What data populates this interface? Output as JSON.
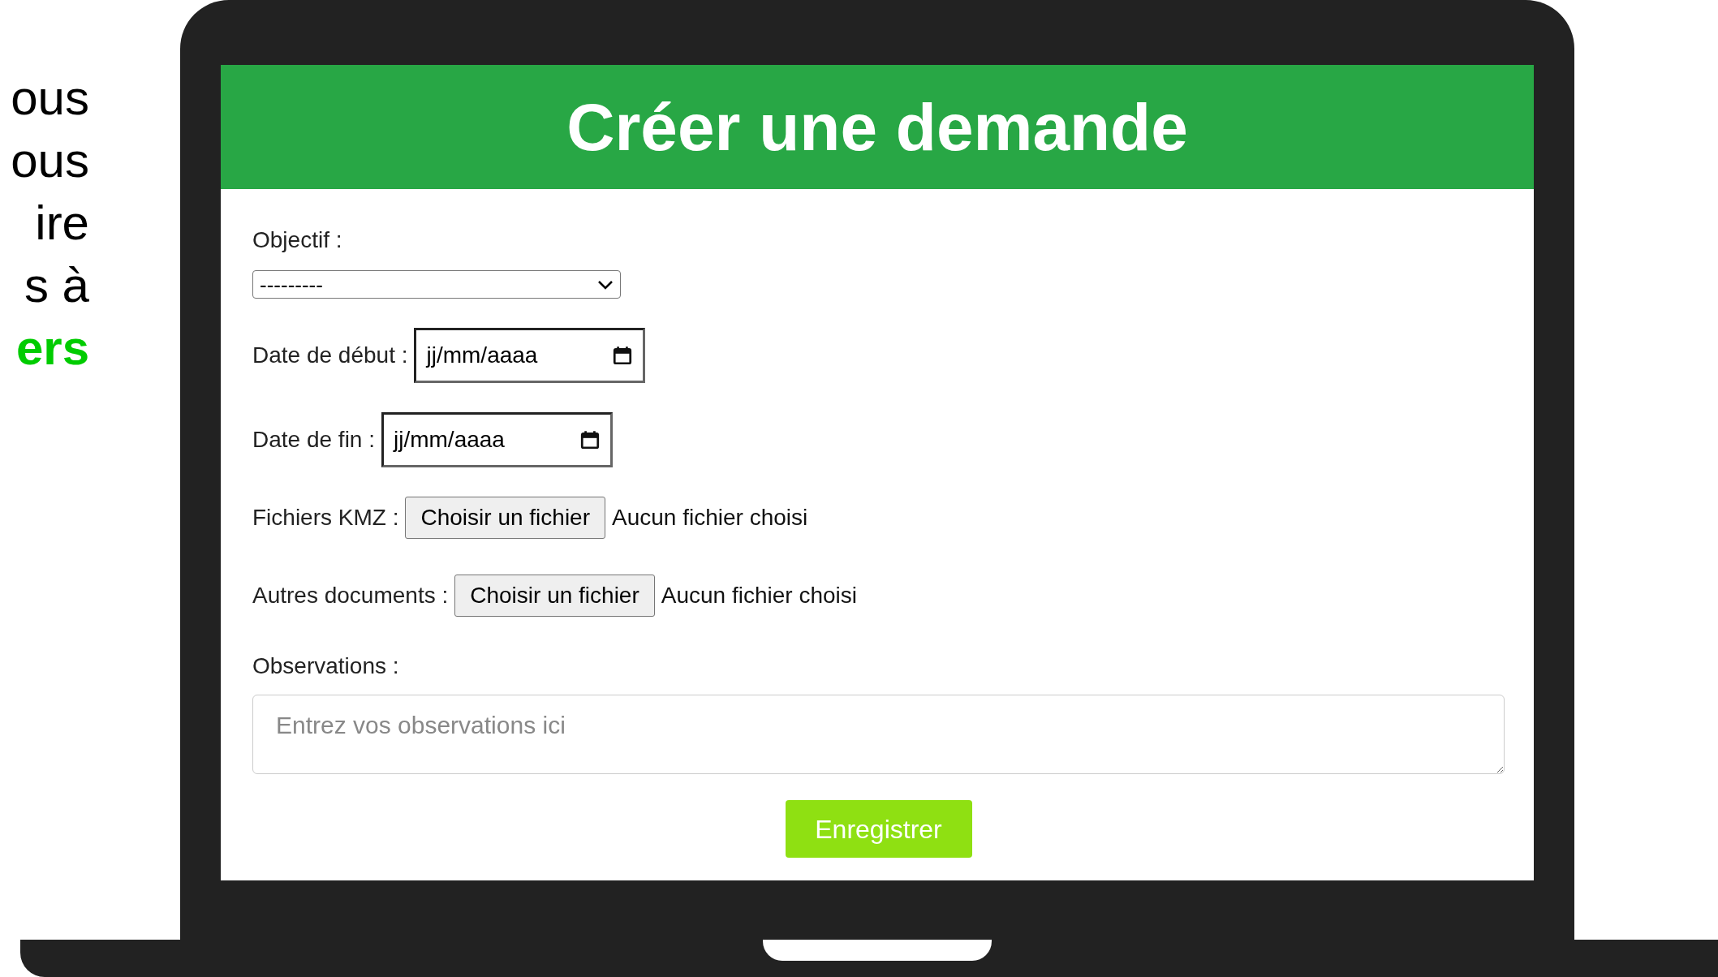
{
  "side_text": [
    {
      "text": "ous",
      "highlight": false
    },
    {
      "text": "ous",
      "highlight": false
    },
    {
      "text": "ire",
      "highlight": false
    },
    {
      "text": "s à",
      "highlight": false
    },
    {
      "text": "ers",
      "highlight": true
    }
  ],
  "form": {
    "title": "Créer une demande",
    "fields": [
      {
        "kind": "select",
        "label": "Objectif :",
        "value": "---------"
      },
      {
        "kind": "date",
        "label": "Date de début :",
        "placeholder": "jj/mm/aaaa"
      },
      {
        "kind": "date",
        "label": "Date de fin :",
        "placeholder": "jj/mm/aaaa"
      },
      {
        "kind": "file",
        "label": "Fichiers KMZ :",
        "button": "Choisir un fichier",
        "status": "Aucun fichier choisi"
      },
      {
        "kind": "file",
        "label": "Autres documents :",
        "button": "Choisir un fichier",
        "status": "Aucun fichier choisi"
      },
      {
        "kind": "textarea",
        "label": "Observations :",
        "placeholder": "Entrez vos observations ici"
      }
    ],
    "submit": "Enregistrer"
  }
}
